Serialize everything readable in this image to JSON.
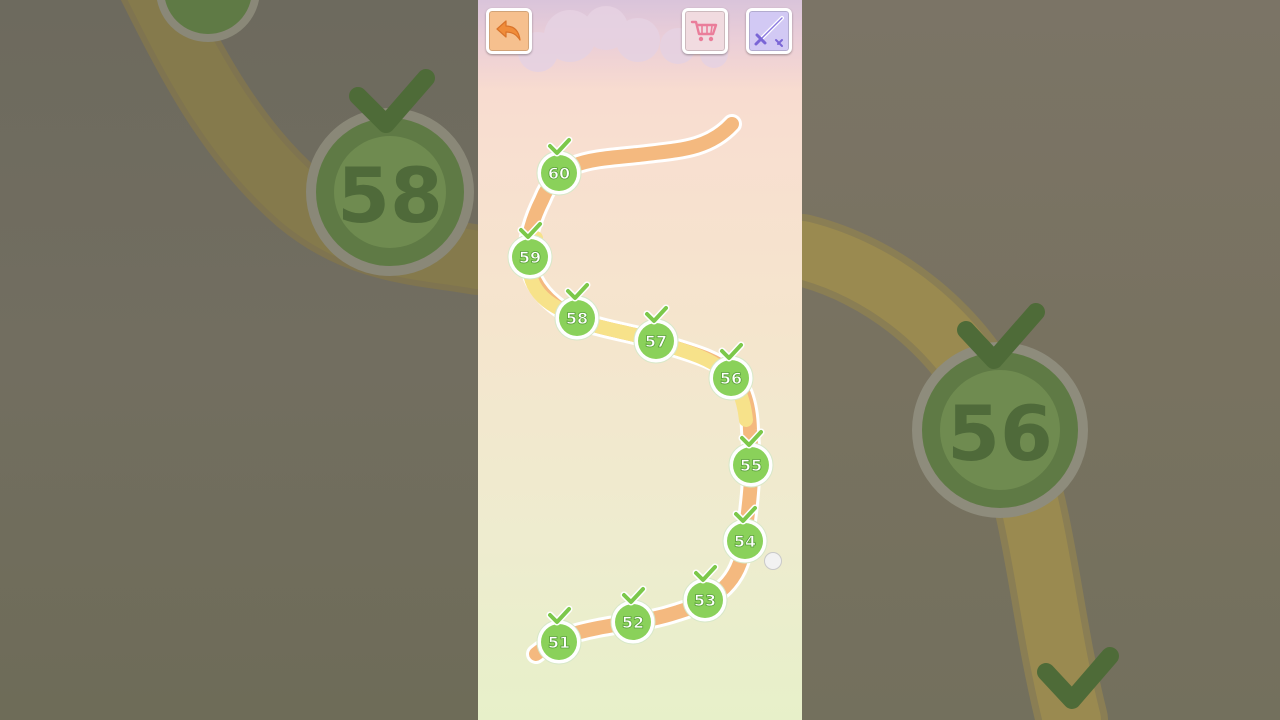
{
  "toolbar": {
    "back_icon": "back-arrow-icon",
    "shop_icon": "shopping-cart-icon",
    "weapon_icon": "sword-icon"
  },
  "levels": [
    {
      "number": "51",
      "completed": true
    },
    {
      "number": "52",
      "completed": true
    },
    {
      "number": "53",
      "completed": true
    },
    {
      "number": "54",
      "completed": true
    },
    {
      "number": "55",
      "completed": true
    },
    {
      "number": "56",
      "completed": true
    },
    {
      "number": "57",
      "completed": true
    },
    {
      "number": "58",
      "completed": true
    },
    {
      "number": "59",
      "completed": true
    },
    {
      "number": "60",
      "completed": true
    }
  ],
  "background_zoom": {
    "left_level": "58",
    "right_level": "56"
  },
  "colors": {
    "level_green": "#8ad15a",
    "level_ring": "#ffffff",
    "check_green": "#7cc84a",
    "path_orange": "#f4b97f",
    "path_yellow": "#f7e28a"
  }
}
